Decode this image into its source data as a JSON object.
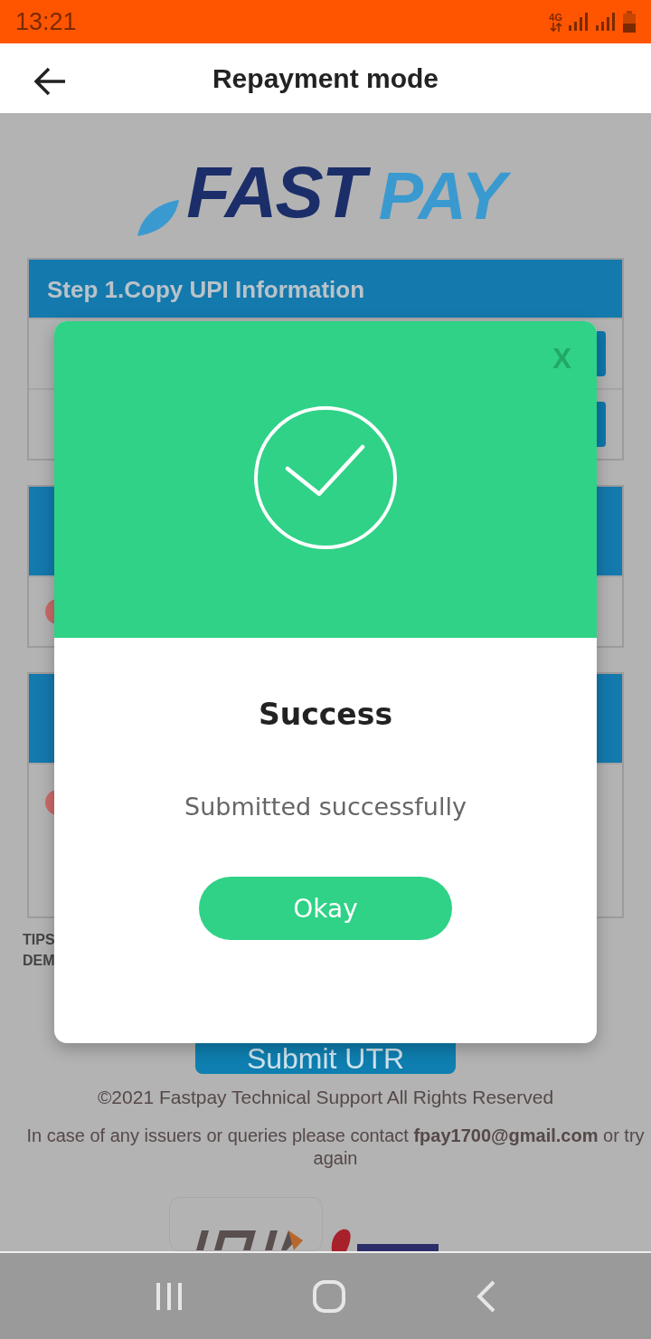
{
  "status_bar": {
    "time": "13:21",
    "network": "4G"
  },
  "header": {
    "title": "Repayment mode"
  },
  "logo": {
    "word_1": "FAST",
    "word_2": "PAY"
  },
  "steps": [
    {
      "title_lines": [
        "Step 1.Copy UPI Information"
      ],
      "rows": [
        {
          "kind": "copy"
        },
        {
          "kind": "copy"
        }
      ]
    },
    {
      "rows": [
        {
          "kind": "option"
        }
      ]
    },
    {
      "rows": [
        {
          "kind": "option_tall"
        }
      ]
    }
  ],
  "tips": [
    "TIPS",
    "DEM"
  ],
  "submit_button": "Submit UTR",
  "footer": {
    "copyright": "©2021 Fastpay Technical Support All Rights Reserved",
    "contact": "In case of any issuers or queries please contact **fpay1700@gmail.com** or try again"
  },
  "dialog": {
    "close": "X",
    "title": "Success",
    "message": "Submitted successfully",
    "button": "Okay"
  }
}
